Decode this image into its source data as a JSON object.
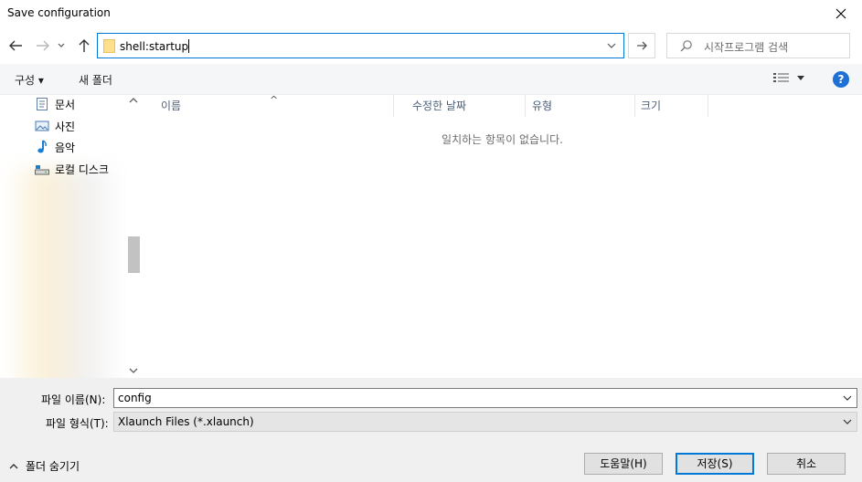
{
  "window": {
    "title": "Save configuration"
  },
  "nav": {
    "address": "shell:startup",
    "search_placeholder": "시작프로그램 검색"
  },
  "toolbar": {
    "organize_label": "구성 ▾",
    "new_folder_label": "새 폴더"
  },
  "sidebar": {
    "items": [
      {
        "label": "문서",
        "icon": "document-icon"
      },
      {
        "label": "사진",
        "icon": "pictures-icon"
      },
      {
        "label": "음악",
        "icon": "music-icon"
      },
      {
        "label": "로컬 디스크",
        "icon": "disk-icon"
      }
    ]
  },
  "columns": [
    "이름",
    "수정한 날짜",
    "유형",
    "크기"
  ],
  "empty_message": "일치하는 항목이 없습니다.",
  "form": {
    "filename_label": "파일 이름(N):",
    "filename_value": "config",
    "filetype_label": "파일 형식(T):",
    "filetype_value": "Xlaunch Files (*.xlaunch)"
  },
  "footer": {
    "hide_folders_label": "폴더 숨기기",
    "help_button": "도움말(H)",
    "save_button": "저장(S)",
    "cancel_button": "취소"
  },
  "colors": {
    "accent": "#0078d7",
    "help": "#1e6fd6"
  }
}
